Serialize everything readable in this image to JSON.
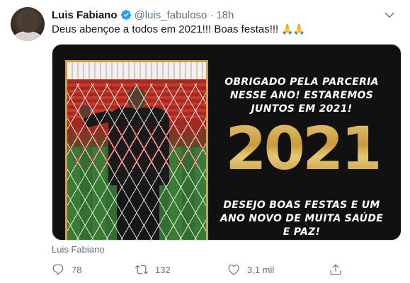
{
  "tweet": {
    "author_name": "Luis Fabiano",
    "handle": "@luis_fabuloso",
    "separator": "·",
    "time": "18h",
    "text": "Deus abençoe a todos em 2021!!! Boas festas!!!",
    "emoji": "🙏🙏",
    "source": "Luis Fabiano",
    "more_icon": "chevron-down-icon"
  },
  "media": {
    "promo_top": "OBRIGADO PELA PARCERIA NESSE ANO! ESTAREMOS JUNTOS EM 2021!",
    "year": "2021",
    "promo_bottom": "DESEJO BOAS FESTAS E UM ANO NOVO DE MUITA SAÚDE E PAZ!"
  },
  "actions": {
    "reply_count": "78",
    "retweet_count": "132",
    "like_count": "3,1 mil"
  },
  "colors": {
    "verified": "#1da1f2",
    "muted": "#5b7083",
    "gold": "#d4ae55"
  }
}
